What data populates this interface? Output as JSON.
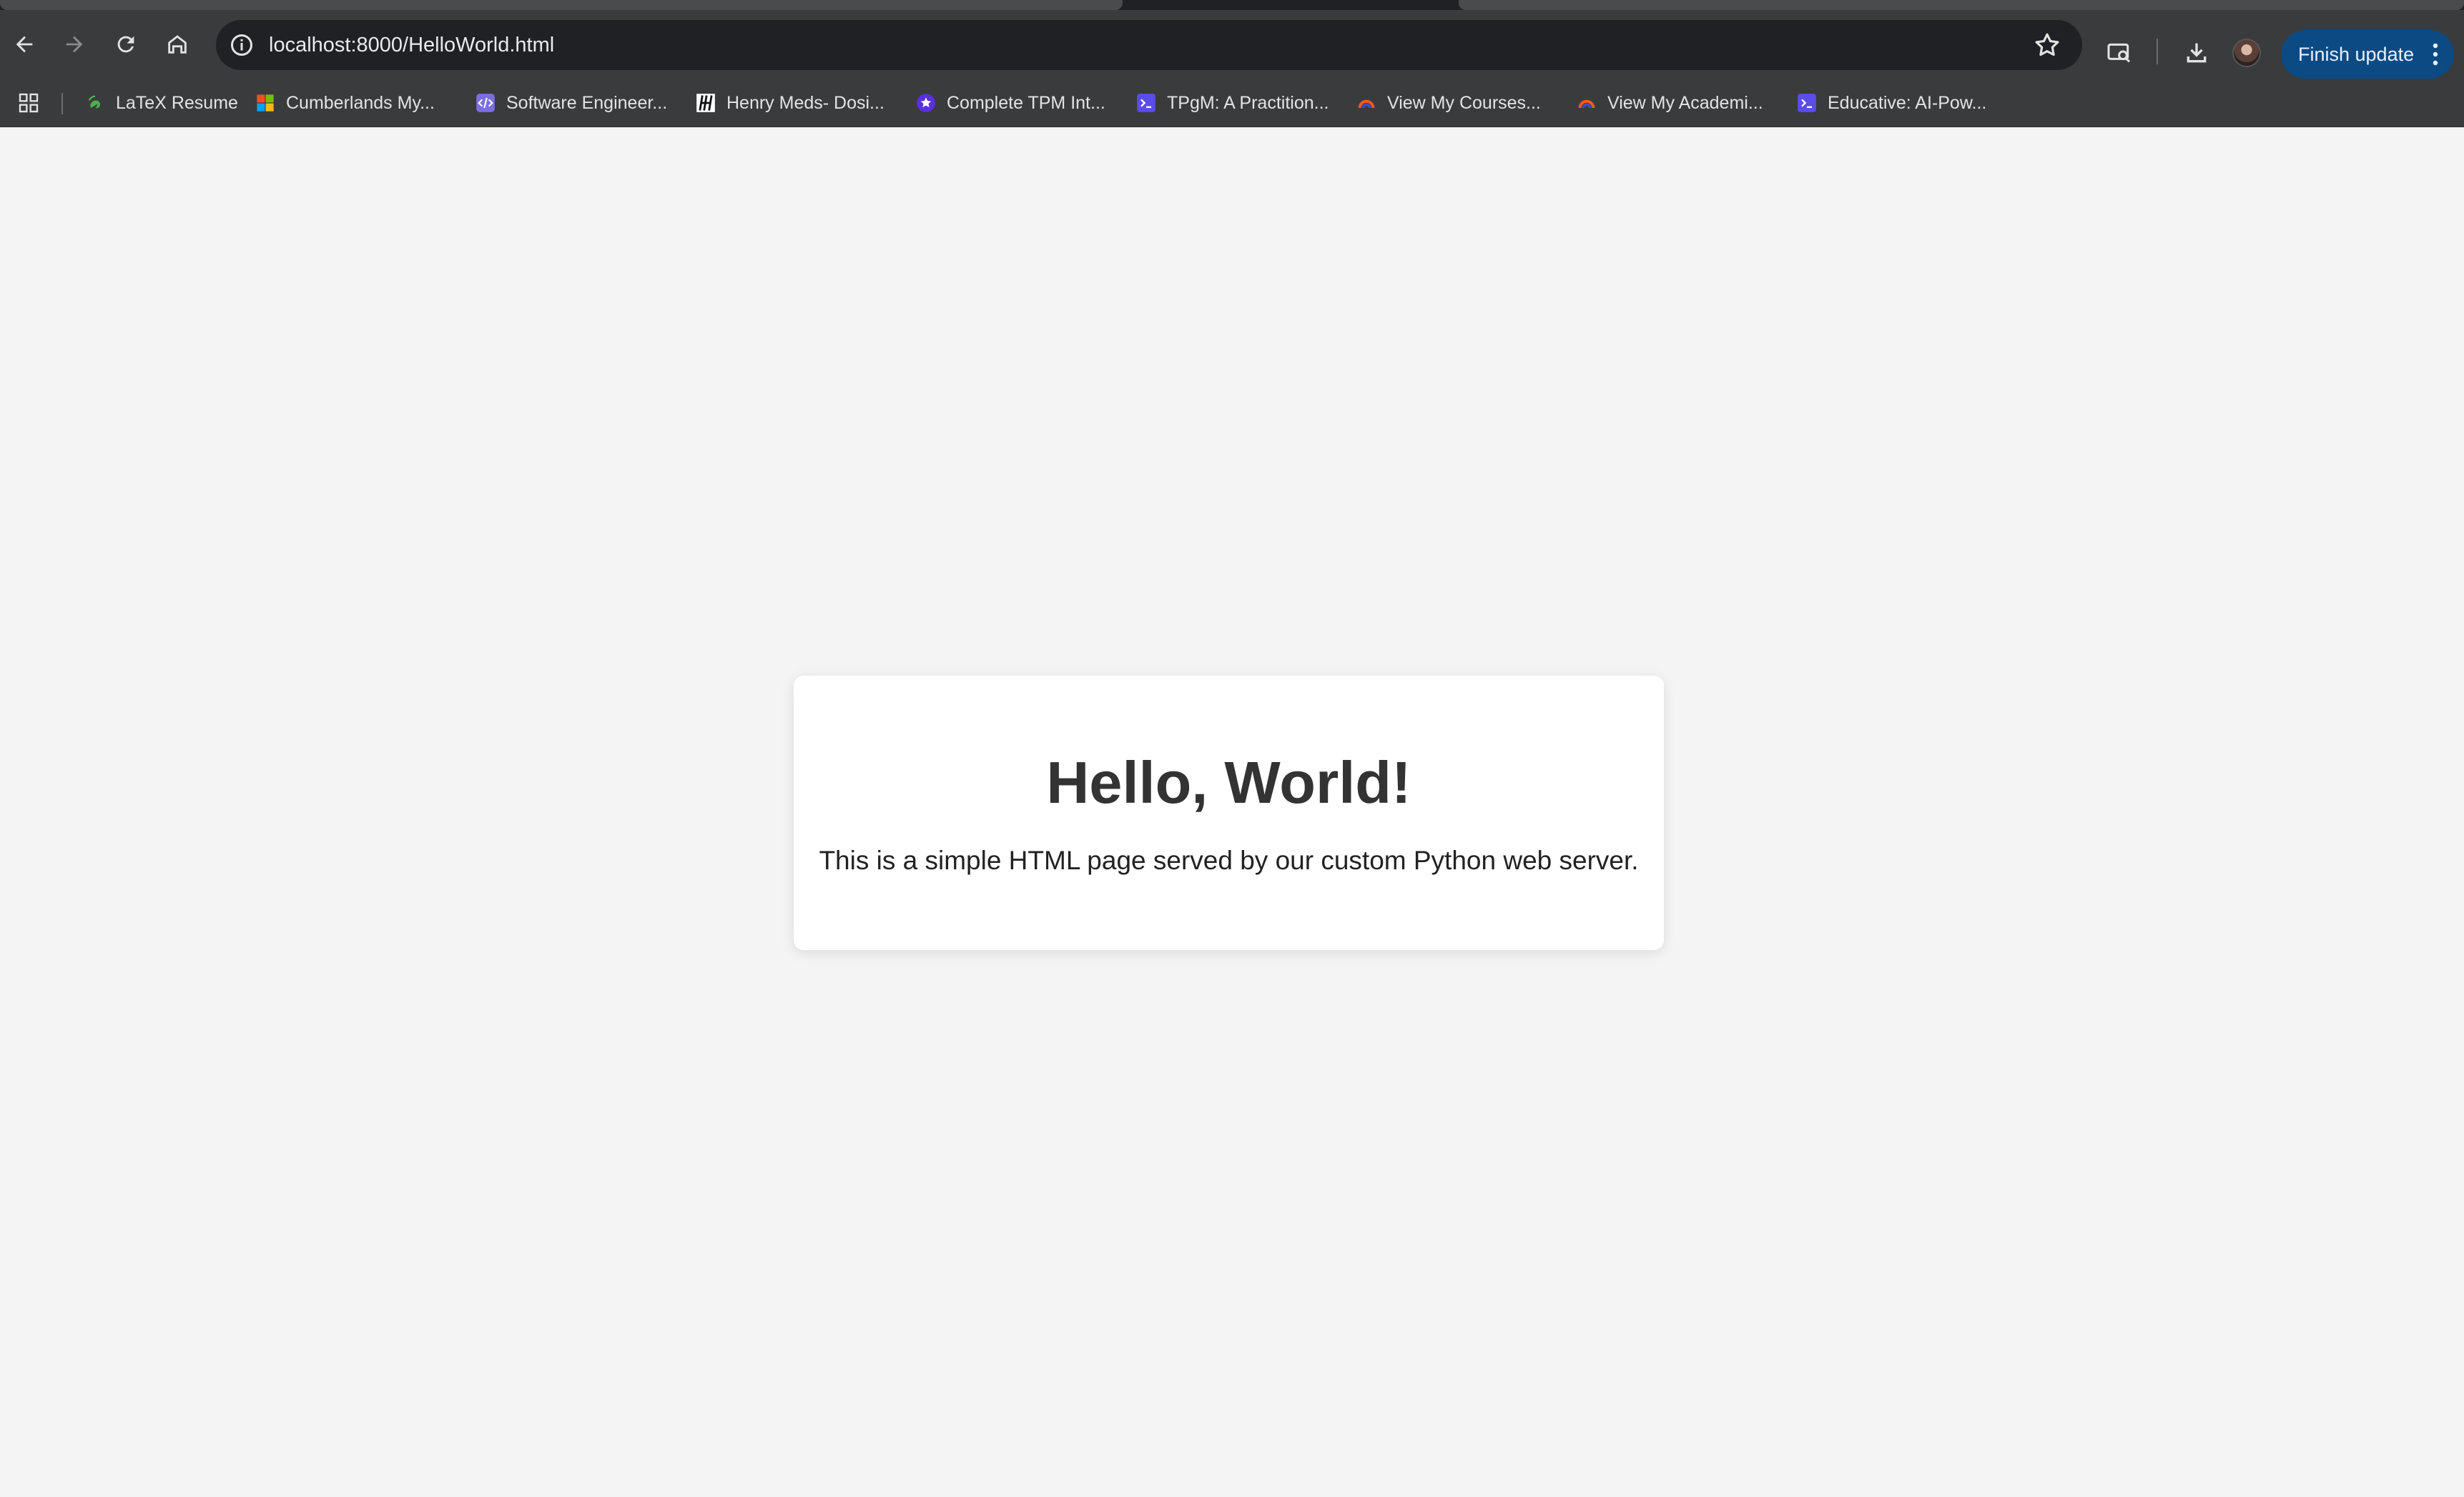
{
  "browser": {
    "url": "localhost:8000/HelloWorld.html",
    "finish_update_label": "Finish update",
    "accent_color": "#0b4a82"
  },
  "bookmarks": [
    {
      "label": "LaTeX Resume",
      "icon": "overleaf-icon"
    },
    {
      "label": "Cumberlands My...",
      "icon": "microsoft-icon"
    },
    {
      "label": "Software Engineer...",
      "icon": "code-icon"
    },
    {
      "label": "Henry Meds- Dosi...",
      "icon": "henry-meds-icon"
    },
    {
      "label": "Complete TPM Int...",
      "icon": "star-badge-icon"
    },
    {
      "label": "TPgM: A Practition...",
      "icon": "terminal-icon"
    },
    {
      "label": "View My Courses...",
      "icon": "arc-icon"
    },
    {
      "label": "View My Academi...",
      "icon": "arc-icon"
    },
    {
      "label": "Educative: AI-Pow...",
      "icon": "terminal-icon"
    }
  ],
  "page": {
    "heading": "Hello, World!",
    "body_text": "This is a simple HTML page served by our custom Python web server."
  }
}
